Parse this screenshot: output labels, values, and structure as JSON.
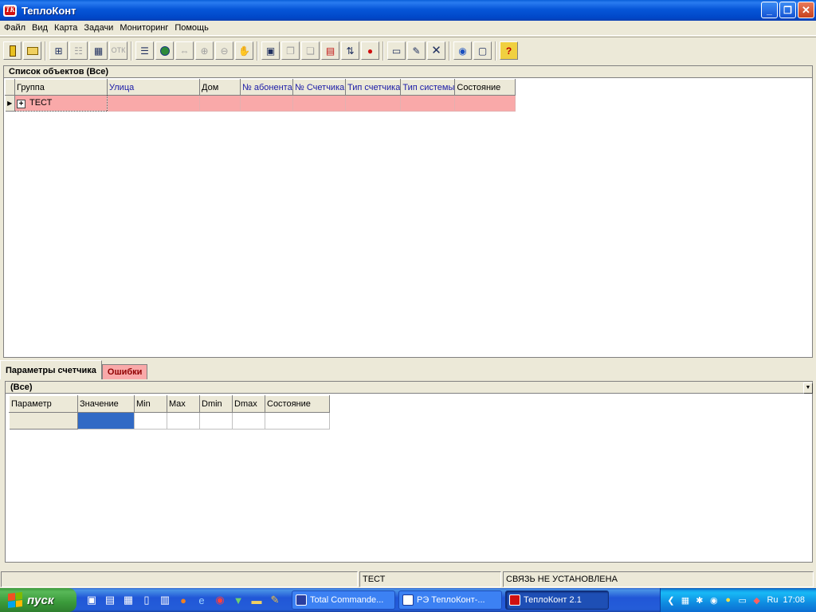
{
  "window": {
    "title": "ТеплоКонт",
    "icon_label": "TK",
    "buttons": {
      "minimize": "_",
      "maximize": "❐",
      "close": "✕"
    }
  },
  "menu": [
    "Файл",
    "Вид",
    "Карта",
    "Задачи",
    "Мониторинг",
    "Помощь"
  ],
  "toolbar": {
    "icons": [
      "exit-icon",
      "open-folder-icon",
      "tree-view-icon",
      "reports-icon",
      "table-icon",
      "otk-icon",
      "document-list-icon",
      "map-icon",
      "fit-map-icon",
      "zoom-in-icon",
      "zoom-out-icon",
      "pan-icon",
      "read-data-icon",
      "copy-icon",
      "paste-icon",
      "save-icon",
      "network-icon",
      "bug-icon",
      "notes-icon",
      "edit-note-icon",
      "delete-icon",
      "globe-icon",
      "monitor-icon",
      "help-icon"
    ],
    "otk_label": "ОТК"
  },
  "objects_panel": {
    "caption": "Список объектов (Все)",
    "columns": [
      "Группа",
      "Улица",
      "Дом",
      "№ абонента",
      "№ Счетчика",
      "Тип счетчика",
      "Тип системы",
      "Состояние"
    ],
    "rows": [
      {
        "group": "ТЕСТ",
        "street": "",
        "house": "",
        "subscriber_no": "",
        "meter_no": "",
        "meter_type": "",
        "system_type": "",
        "state": ""
      }
    ],
    "row_indicator": "▶",
    "expand_glyph": "+"
  },
  "tabs": [
    {
      "label": "Параметры счетчика",
      "active": true
    },
    {
      "label": "Ошибки",
      "active": false
    }
  ],
  "params_panel": {
    "caption": "(Все)",
    "dropdown_glyph": "▼",
    "columns": [
      "Параметр",
      "Значение",
      "Min",
      "Max",
      "Dmin",
      "Dmax",
      "Состояние"
    ]
  },
  "statusbar": {
    "cells": [
      "",
      "ТЕСТ",
      "СВЯЗЬ НЕ УСТАНОВЛЕНА"
    ]
  },
  "taskbar": {
    "start_label": "пуск",
    "tasks": [
      {
        "label": "Total Commande...",
        "icon_color": "#2a3fa0",
        "active": false
      },
      {
        "label": "РЭ ТеплоКонт-...",
        "icon_color": "#ffffff",
        "active": false
      },
      {
        "label": "ТеплоКонт 2.1",
        "icon_color": "#d01010",
        "active": true
      }
    ],
    "tray": {
      "language": "Ru",
      "clock": "17:08"
    }
  },
  "colors": {
    "row_highlight": "#f9a9a9",
    "selection": "#316ac5",
    "xp_blue": "#0047c8"
  }
}
